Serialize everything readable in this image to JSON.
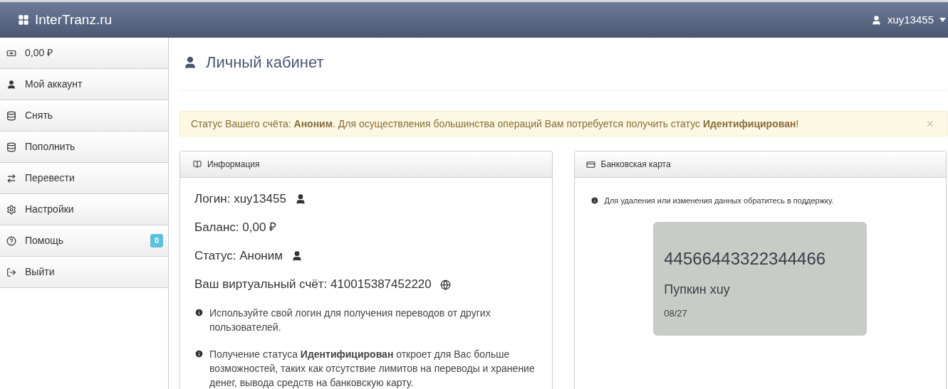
{
  "navbar": {
    "brand": "InterTranz.ru",
    "user": "xuy13455"
  },
  "sidebar": {
    "items": [
      {
        "kind": "money",
        "label": "0,00 ₽"
      },
      {
        "kind": "user",
        "label": "Мой аккаунт"
      },
      {
        "kind": "database",
        "label": "Снять"
      },
      {
        "kind": "database",
        "label": "Пополнить"
      },
      {
        "kind": "exchange",
        "label": "Перевести"
      },
      {
        "kind": "settings",
        "label": "Настройки"
      },
      {
        "kind": "help",
        "label": "Помощь",
        "badge": "0"
      },
      {
        "kind": "logout",
        "label": "Выйти"
      }
    ]
  },
  "page_title": "Личный кабинет",
  "alert": {
    "text": "Статус Вашего счёта: **Аноним**. Для осуществления большинства операций Вам потребуется получить статус **Идентифицирован**!",
    "close": "×"
  },
  "info_panel": {
    "title": "Информация",
    "lines": [
      {
        "text": "Логин: xuy13455",
        "kind": "user"
      },
      {
        "text": "Баланс: 0,00 ₽",
        "kind": "none"
      },
      {
        "text": "Статус: Аноним",
        "kind": "user"
      },
      {
        "text": "Ваш виртуальный счёт: 410015387452220",
        "kind": "globe"
      }
    ],
    "notes": [
      "Используйте свой логин для получения переводов от других пользователей.",
      "Получение статуса **Идентифицирован** откроет для Вас больше возможностей, таких как отсутствие лимитов на переводы и хранение денег, вывода средств на банковскую карту."
    ]
  },
  "card_panel": {
    "title": "Банковская карта",
    "note": "Для удаления или изменения данных обратитесь в поддержку.",
    "card": {
      "number": "44566443322344466",
      "holder": "Пупкин xuy",
      "expiry": "08/27"
    }
  }
}
